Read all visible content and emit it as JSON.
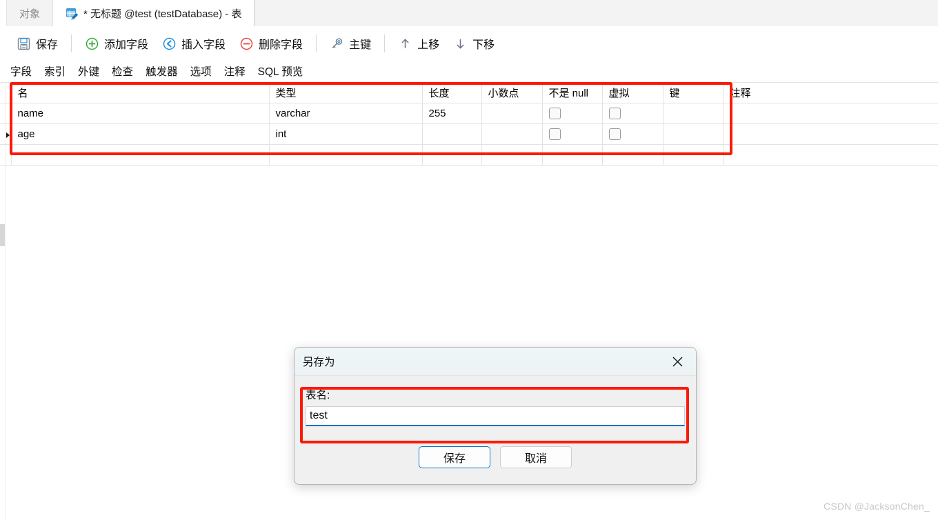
{
  "window": {
    "tabs": [
      {
        "label": "对象",
        "active": false,
        "icon": null
      },
      {
        "label": "* 无标题 @test (testDatabase) - 表",
        "active": true,
        "icon": "table-edit-icon"
      }
    ]
  },
  "toolbar": {
    "buttons": [
      {
        "label": "保存",
        "icon": "save-icon"
      },
      {
        "label": "添加字段",
        "icon": "plus-circle-icon"
      },
      {
        "label": "插入字段",
        "icon": "arrow-left-circle-icon"
      },
      {
        "label": "删除字段",
        "icon": "minus-circle-icon"
      },
      {
        "label": "主键",
        "icon": "key-icon"
      },
      {
        "label": "上移",
        "icon": "arrow-up-icon"
      },
      {
        "label": "下移",
        "icon": "arrow-down-icon"
      }
    ]
  },
  "subtabs": {
    "items": [
      {
        "label": "字段",
        "active": true
      },
      {
        "label": "索引",
        "active": false
      },
      {
        "label": "外键",
        "active": false
      },
      {
        "label": "检查",
        "active": false
      },
      {
        "label": "触发器",
        "active": false
      },
      {
        "label": "选项",
        "active": false
      },
      {
        "label": "注释",
        "active": false
      },
      {
        "label": "SQL 预览",
        "active": false
      }
    ]
  },
  "grid": {
    "columns": [
      {
        "key": "name",
        "label": "名"
      },
      {
        "key": "type",
        "label": "类型"
      },
      {
        "key": "length",
        "label": "长度"
      },
      {
        "key": "decimals",
        "label": "小数点"
      },
      {
        "key": "notnull",
        "label": "不是 null"
      },
      {
        "key": "virtual",
        "label": "虚拟"
      },
      {
        "key": "key",
        "label": "键"
      },
      {
        "key": "comment",
        "label": "注释"
      }
    ],
    "rows": [
      {
        "selected": false,
        "name": "name",
        "type": "varchar",
        "length": "255",
        "decimals": "",
        "notnull": false,
        "virtual": false,
        "key": "",
        "comment": ""
      },
      {
        "selected": true,
        "name": "age",
        "type": "int",
        "length": "",
        "decimals": "",
        "notnull": false,
        "virtual": false,
        "key": "",
        "comment": ""
      },
      {
        "selected": false,
        "name": "",
        "type": "",
        "length": "",
        "decimals": "",
        "notnull": null,
        "virtual": null,
        "key": "",
        "comment": ""
      }
    ]
  },
  "dialog": {
    "title": "另存为",
    "close_label": "✕",
    "field_label": "表名:",
    "field_value": "test",
    "field_placeholder": "",
    "save_label": "保存",
    "cancel_label": "取消"
  },
  "watermark": {
    "text": "CSDN @JacksonChen_"
  },
  "colors": {
    "annotation_red": "#fb1a09",
    "accent_blue": "#0a6ec9",
    "add_green": "#37a83a",
    "insert_blue": "#1f8fe0",
    "delete_red": "#e8443c",
    "dialog_bg": "#f0f0f0"
  }
}
